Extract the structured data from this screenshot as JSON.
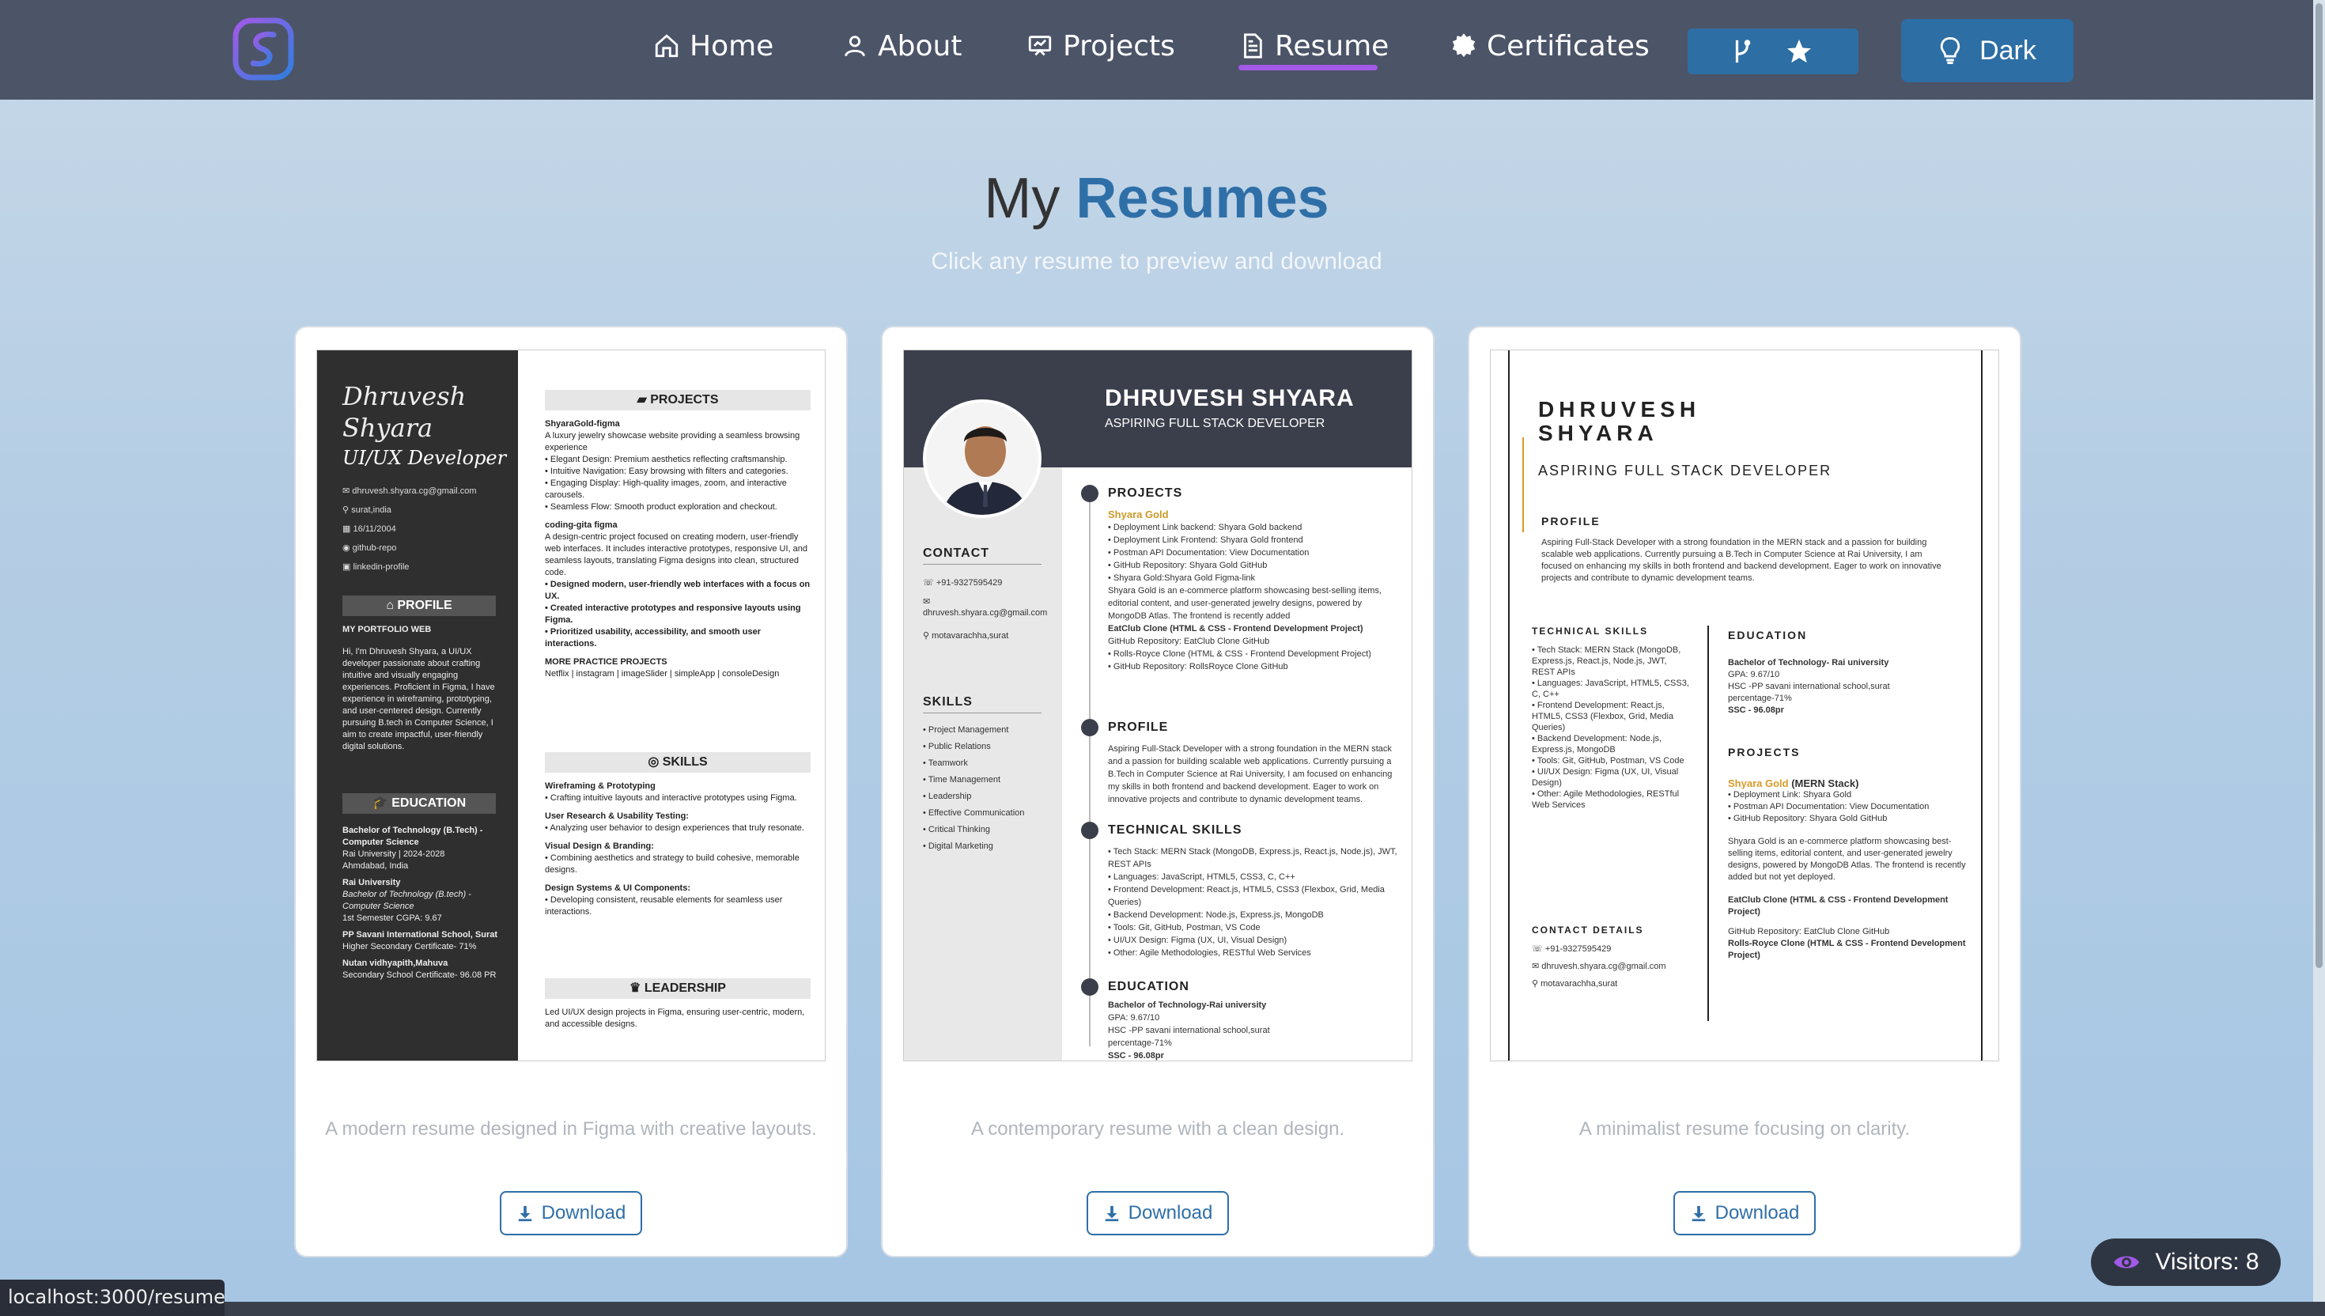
{
  "nav": {
    "home": "Home",
    "about": "About",
    "projects": "Projects",
    "resume": "Resume",
    "certificates": "Certificates",
    "theme_toggle": "Dark"
  },
  "header": {
    "title_prefix": "My",
    "title_accent": "Resumes",
    "subtitle": "Click any resume to preview and download"
  },
  "cards": [
    {
      "description": "A modern resume designed in Figma with creative layouts.",
      "download_label": "Download"
    },
    {
      "description": "A contemporary resume with a clean design.",
      "download_label": "Download"
    },
    {
      "description": "A minimalist resume focusing on clarity.",
      "download_label": "Download"
    }
  ],
  "resume1": {
    "name_line1": "Dhruvesh",
    "name_line2": "Shyara",
    "role": "UI/UX Developer",
    "email": "dhruvesh.shyara.cg@gmail.com",
    "location": "surat,india",
    "dob": "16/11/2004",
    "github": "github-repo",
    "linkedin": "linkedin-profile",
    "profile_h": "PROFILE",
    "portfolio": "MY PORTFOLIO WEB",
    "profile_text": "Hi, I'm Dhruvesh Shyara, a UI/UX developer passionate about crafting intuitive and visually engaging experiences. Proficient in Figma, I have experience in wireframing, prototyping, and user-centered design. Currently pursuing B.tech in Computer Science, I aim to create impactful, user-friendly digital solutions.",
    "education_h": "EDUCATION",
    "edu1": "Bachelor of Technology (B.Tech) - Computer Science",
    "edu1b": "Rai University | 2024-2028",
    "edu1c": "Ahmdabad, India",
    "edu2": "Rai University",
    "edu2b": "Bachelor of Technology (B.tech) - Computer Science",
    "edu2c": "1st Semester CGPA: 9.67",
    "edu3": "PP Savani International School, Surat",
    "edu3b": "Higher Secondary Certificate- 71%",
    "edu4": "Nutan vidhyapith,Mahuva",
    "edu4b": "Secondary School Certificate- 96.08 PR",
    "projects_h": "PROJECTS",
    "p1_title": "ShyaraGold-figma",
    "p1_desc": "A luxury jewelry showcase website providing a seamless browsing experience",
    "p1_b1": "Elegant Design: Premium aesthetics reflecting craftsmanship.",
    "p1_b2": "Intuitive Navigation: Easy browsing with filters and categories.",
    "p1_b3": "Engaging Display: High-quality images, zoom, and interactive carousels.",
    "p1_b4": "Seamless Flow: Smooth product exploration and checkout.",
    "p2_title": "coding-gita figma",
    "p2_desc": "A design-centric project focused on creating modern, user-friendly web interfaces. It includes interactive prototypes, responsive UI, and seamless layouts, translating Figma designs into clean, structured code.",
    "p2_b1": "Designed modern, user-friendly web interfaces with a focus on UX.",
    "p2_b2": "Created interactive prototypes and responsive layouts using Figma.",
    "p2_b3": "Prioritized usability, accessibility, and smooth user interactions.",
    "more_h": "MORE PRACTICE PROJECTS",
    "more": "Netflix | instagram | imageSlider | simpleApp | consoleDesign",
    "skills_h": "SKILLS",
    "s1": "Wireframing & Prototyping",
    "s1b": "Crafting intuitive layouts and interactive prototypes using Figma.",
    "s2": "User Research & Usability Testing:",
    "s2b": "Analyzing user behavior to design experiences that truly resonate.",
    "s3": "Visual Design & Branding:",
    "s3b": "Combining aesthetics and strategy to build cohesive, memorable designs.",
    "s4": "Design Systems & UI Components:",
    "s4b": "Developing consistent, reusable elements for seamless user interactions.",
    "leadership_h": "LEADERSHIP",
    "lead": "Led UI/UX design projects in Figma, ensuring user-centric, modern, and accessible designs."
  },
  "resume2": {
    "name": "DHRUVESH SHYARA",
    "role": "ASPIRING FULL STACK DEVELOPER",
    "contact_h": "CONTACT",
    "phone": "+91-9327595429",
    "email": "dhruvesh.shyara.cg@gmail.com",
    "address": "motavarachha,surat",
    "skills_h": "SKILLS",
    "skills": [
      "Project Management",
      "Public Relations",
      "Teamwork",
      "Time Management",
      "Leadership",
      "Effective Communication",
      "Critical Thinking",
      "Digital Marketing"
    ],
    "projects_h": "PROJECTS",
    "p_title": "Shyara Gold",
    "p_l1": "Deployment Link backend: Shyara Gold backend",
    "p_l2": "Deployment Link Frontend: Shyara Gold frontend",
    "p_l3": "Postman API Documentation: View Documentation",
    "p_l4": "GitHub Repository: Shyara Gold GitHub",
    "p_l5": "Shyara Gold:Shyara Gold Figma-link",
    "p_desc": "Shyara Gold is an e-commerce platform showcasing best-selling items, editorial content, and user-generated jewelry designs, powered by MongoDB Atlas. The frontend is recently added",
    "p2": "EatClub Clone (HTML & CSS - Frontend Development Project)",
    "p2b": "GitHub Repository: EatClub Clone GitHub",
    "p3": "Rolls-Royce Clone (HTML & CSS - Frontend Development Project)",
    "p3b": "GitHub Repository: RollsRoyce Clone GitHub",
    "profile_h": "PROFILE",
    "profile": "Aspiring Full-Stack Developer with a strong foundation in the MERN stack and a passion for building scalable web applications. Currently pursuing a B.Tech in Computer Science at Rai University, I am focused on enhancing my skills in both frontend and backend development. Eager to work on innovative projects and contribute to dynamic development teams.",
    "tech_h": "TECHNICAL SKILLS",
    "tech": [
      "Tech Stack: MERN Stack (MongoDB, Express.js, React.js, Node.js), JWT, REST APIs",
      "Languages: JavaScript, HTML5, CSS3, C, C++",
      "Frontend Development: React.js, HTML5, CSS3 (Flexbox, Grid, Media Queries)",
      "Backend Development: Node.js, Express.js, MongoDB",
      "Tools: Git, GitHub, Postman, VS Code",
      "UI/UX Design: Figma (UX, UI, Visual Design)",
      "Other: Agile Methodologies, RESTful Web Services"
    ],
    "edu_h": "EDUCATION",
    "edu1": "Bachelor of Technology-Rai university",
    "edu2": "GPA: 9.67/10",
    "edu3": "HSC -PP savani international school,surat",
    "edu4": "percentage-71%",
    "edu5": "SSC - 96.08pr"
  },
  "resume3": {
    "name_line1": "DHRUVESH",
    "name_line2": "SHYARA",
    "role": "ASPIRING FULL STACK DEVELOPER",
    "profile_h": "PROFILE",
    "profile": "Aspiring Full-Stack Developer with a strong foundation in the MERN stack and a passion for building scalable web applications. Currently pursuing a B.Tech in Computer Science at Rai University, I am focused on enhancing my skills in both frontend and backend development. Eager to work on innovative projects and contribute to dynamic development teams.",
    "tech_h": "TECHNICAL SKILLS",
    "tech": [
      "Tech Stack: MERN Stack (MongoDB, Express.js, React.js, Node.js, JWT, REST APIs",
      "Languages: JavaScript, HTML5, CSS3, C, C++",
      "Frontend Development: React.js, HTML5, CSS3 (Flexbox, Grid, Media Queries)",
      "Backend Development: Node.js, Express.js, MongoDB",
      "Tools: Git, GitHub, Postman, VS Code",
      "UI/UX Design: Figma (UX, UI, Visual Design)",
      "Other: Agile Methodologies, RESTful Web Services"
    ],
    "contact_h": "CONTACT DETAILS",
    "phone": "+91-9327595429",
    "email": "dhruvesh.shyara.cg@gmail.com",
    "address": "motavarachha,surat",
    "edu_h": "EDUCATION",
    "edu1": "Bachelor of Technology- Rai university",
    "edu2": "GPA: 9.67/10",
    "edu3": "HSC -PP savani international school,surat",
    "edu4": "percentage-71%",
    "edu5": "SSC - 96.08pr",
    "projects_h": "PROJECTS",
    "p_title": "Shyara Gold",
    "p_stack": "(MERN Stack)",
    "p_l1": "Deployment Link: Shyara Gold",
    "p_l2": "Postman API Documentation: View Documentation",
    "p_l3": "GitHub Repository: Shyara Gold GitHub",
    "p_desc": "Shyara Gold is an e-commerce platform showcasing best-selling items, editorial content, and user-generated jewelry designs, powered by MongoDB Atlas. The frontend is recently added but not yet deployed.",
    "p2": "EatClub Clone (HTML & CSS - Frontend Development Project)",
    "p2b": "GitHub Repository: EatClub Clone GitHub",
    "p3": "Rolls-Royce Clone (HTML & CSS - Frontend Development Project)"
  },
  "visitors": "Visitors: 8",
  "status_url": "localhost:3000/resume",
  "colors": {
    "nav_bg": "#4c5468",
    "accent": "#2f6fa8",
    "underline": "#a259e6"
  }
}
